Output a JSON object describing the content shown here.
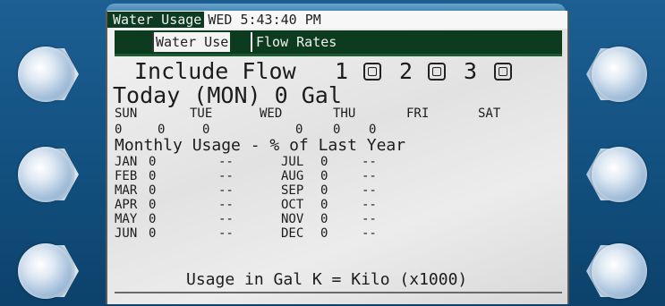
{
  "header": {
    "screen_name": "Water Usage",
    "clock": "WED 5:43:40 PM"
  },
  "tabs": [
    {
      "label": "Water Use",
      "active": false
    },
    {
      "label": "Flow Rates",
      "active": true
    }
  ],
  "include_flow": {
    "label": "Include Flow",
    "items": [
      "1",
      "2",
      "3"
    ]
  },
  "today": {
    "text": "Today (MON) 0 Gal"
  },
  "weekdays": {
    "labels": [
      "SUN",
      "TUE",
      "WED",
      "THU",
      "FRI",
      "SAT"
    ],
    "values": [
      "0",
      "0",
      "0",
      "0",
      "0",
      "0"
    ]
  },
  "monthly": {
    "heading": "Monthly Usage - % of Last Year",
    "rows": [
      {
        "month": "JAN",
        "value": "0",
        "pct": "--"
      },
      {
        "month": "FEB",
        "value": "0",
        "pct": "--"
      },
      {
        "month": "MAR",
        "value": "0",
        "pct": "--"
      },
      {
        "month": "APR",
        "value": "0",
        "pct": "--"
      },
      {
        "month": "MAY",
        "value": "0",
        "pct": "--"
      },
      {
        "month": "JUN",
        "value": "0",
        "pct": "--"
      },
      {
        "month": "JUL",
        "value": "0",
        "pct": "--"
      },
      {
        "month": "AUG",
        "value": "0",
        "pct": "--"
      },
      {
        "month": "SEP",
        "value": "0",
        "pct": "--"
      },
      {
        "month": "OCT",
        "value": "0",
        "pct": "--"
      },
      {
        "month": "NOV",
        "value": "0",
        "pct": "--"
      },
      {
        "month": "DEC",
        "value": "0",
        "pct": "--"
      }
    ]
  },
  "footer": {
    "text": "Usage in Gal K = Kilo (x1000)"
  },
  "colors": {
    "bezel": "#12507f",
    "highlight": "#0d3b20",
    "screen": "#e6e6e6"
  }
}
